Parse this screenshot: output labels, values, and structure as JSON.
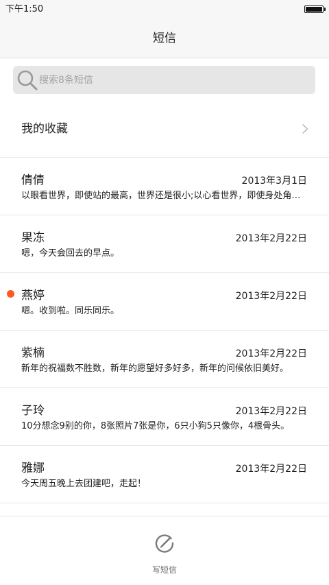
{
  "status_bar": {
    "time": "下午1:50",
    "battery_level": 1.0
  },
  "header": {
    "title": "短信"
  },
  "search": {
    "placeholder": "搜索8条短信",
    "value": ""
  },
  "favorites": {
    "label": "我的收藏"
  },
  "messages": [
    {
      "name": "倩倩",
      "date": "2013年3月1日",
      "preview": "以眼看世界，即使站的最高，世界还是很小;以心看世界，即使身处角落，世界也会很大。",
      "unread": false
    },
    {
      "name": "果冻",
      "date": "2013年2月22日",
      "preview": "嗯，今天会回去的早点。",
      "unread": false
    },
    {
      "name": "燕婷",
      "date": "2013年2月22日",
      "preview": "嗯。收到啦。同乐同乐。",
      "unread": true
    },
    {
      "name": "紫楠",
      "date": "2013年2月22日",
      "preview": "新年的祝福数不胜数，新年的愿望好多好多，新年的问候依旧美好。",
      "unread": false
    },
    {
      "name": "子玲",
      "date": "2013年2月22日",
      "preview": "10分想念9别的你，8张照片7张是你，6只小狗5只像你，4根骨头。",
      "unread": false
    },
    {
      "name": "雅娜",
      "date": "2013年2月22日",
      "preview": "今天周五晚上去团建吧，走起！",
      "unread": false
    }
  ],
  "bottom_bar": {
    "compose_label": "写短信"
  },
  "colors": {
    "unread_dot": "#ff5a1f",
    "search_bg": "#e6e6e6",
    "header_bg": "#f7f7f7"
  }
}
